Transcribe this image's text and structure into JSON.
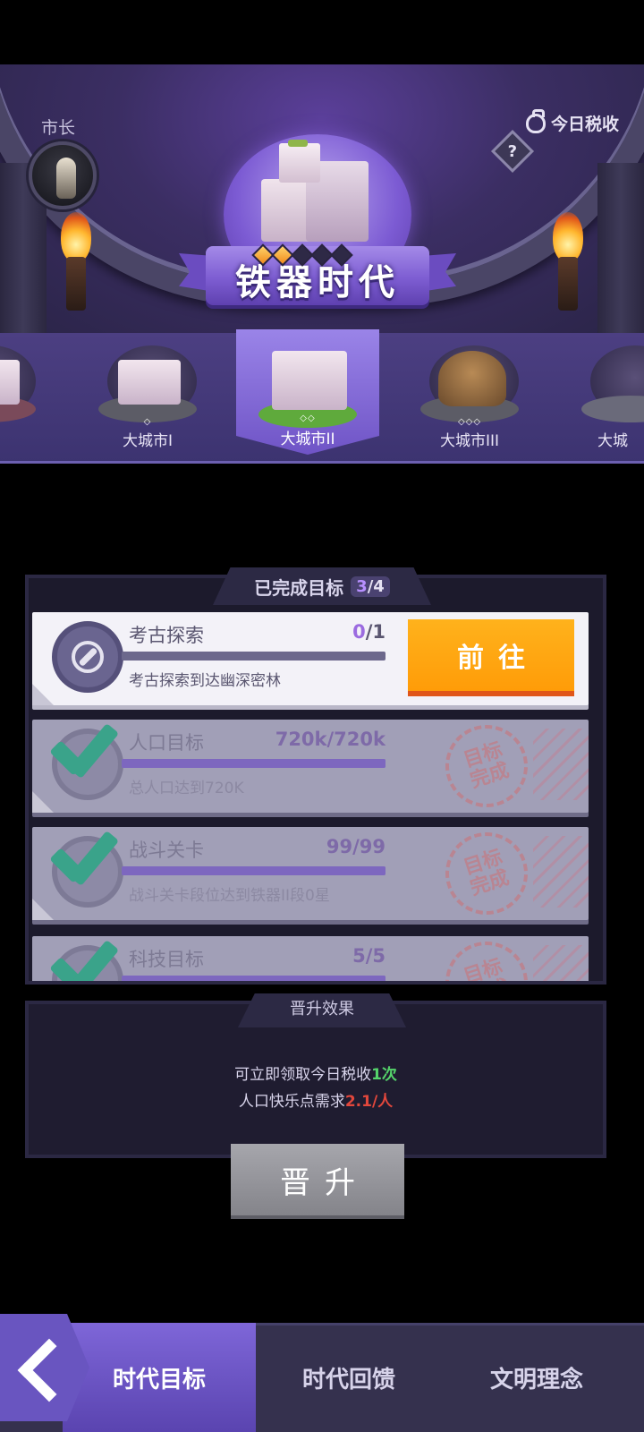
{
  "header": {
    "mayor_label": "市长",
    "tax_link": "今日税收",
    "help": "?",
    "era_title": "铁器时代",
    "era_stars": {
      "earned": 2,
      "total": 5
    }
  },
  "levels": [
    {
      "name": "大城市I",
      "dots": "◇"
    },
    {
      "name": "大城市II",
      "dots": "◇◇",
      "active": true
    },
    {
      "name": "大城市III",
      "dots": "◇◇◇"
    },
    {
      "name": "大城"
    }
  ],
  "goals": {
    "title": "已完成目标",
    "done": "3",
    "total": "/4",
    "items": [
      {
        "title": "考古探索",
        "cur": "0",
        "max": "/1",
        "fraction": 0,
        "desc": "考古探索到达幽深密林",
        "button": "前往",
        "done": false
      },
      {
        "title": "人口目标",
        "cur": "720k",
        "max": "/720k",
        "fraction": 1,
        "desc": "总人口达到720K",
        "stamp": "目标完成",
        "done": true
      },
      {
        "title": "战斗关卡",
        "cur": "99",
        "max": "/99",
        "fraction": 1,
        "desc": "战斗关卡段位达到铁器II段0星",
        "stamp": "目标完成",
        "done": true
      },
      {
        "title": "科技目标",
        "cur": "5",
        "max": "/5",
        "fraction": 1,
        "desc": "",
        "stamp": "目标完成",
        "done": true
      }
    ]
  },
  "effects": {
    "title": "晋升效果",
    "line1_prefix": "可立即领取今日税收",
    "line1_value": "1次",
    "line2_prefix": "人口快乐点需求",
    "line2_value": "2.1/人"
  },
  "promote_button": "晋升",
  "bottom_nav": {
    "tab1": "时代目标",
    "tab2": "时代回馈",
    "tab3": "文明理念"
  },
  "colors": {
    "accent_orange": "#ff9c08",
    "accent_purple": "#7e66d8",
    "green_value": "#55d46b",
    "red_value": "#e2473c"
  },
  "icons": {
    "help": "question-diamond-icon",
    "tax": "money-bag-icon",
    "goal_active": "compass-icon",
    "goal_done": "checkmark-icon",
    "back": "chevron-left-icon"
  }
}
